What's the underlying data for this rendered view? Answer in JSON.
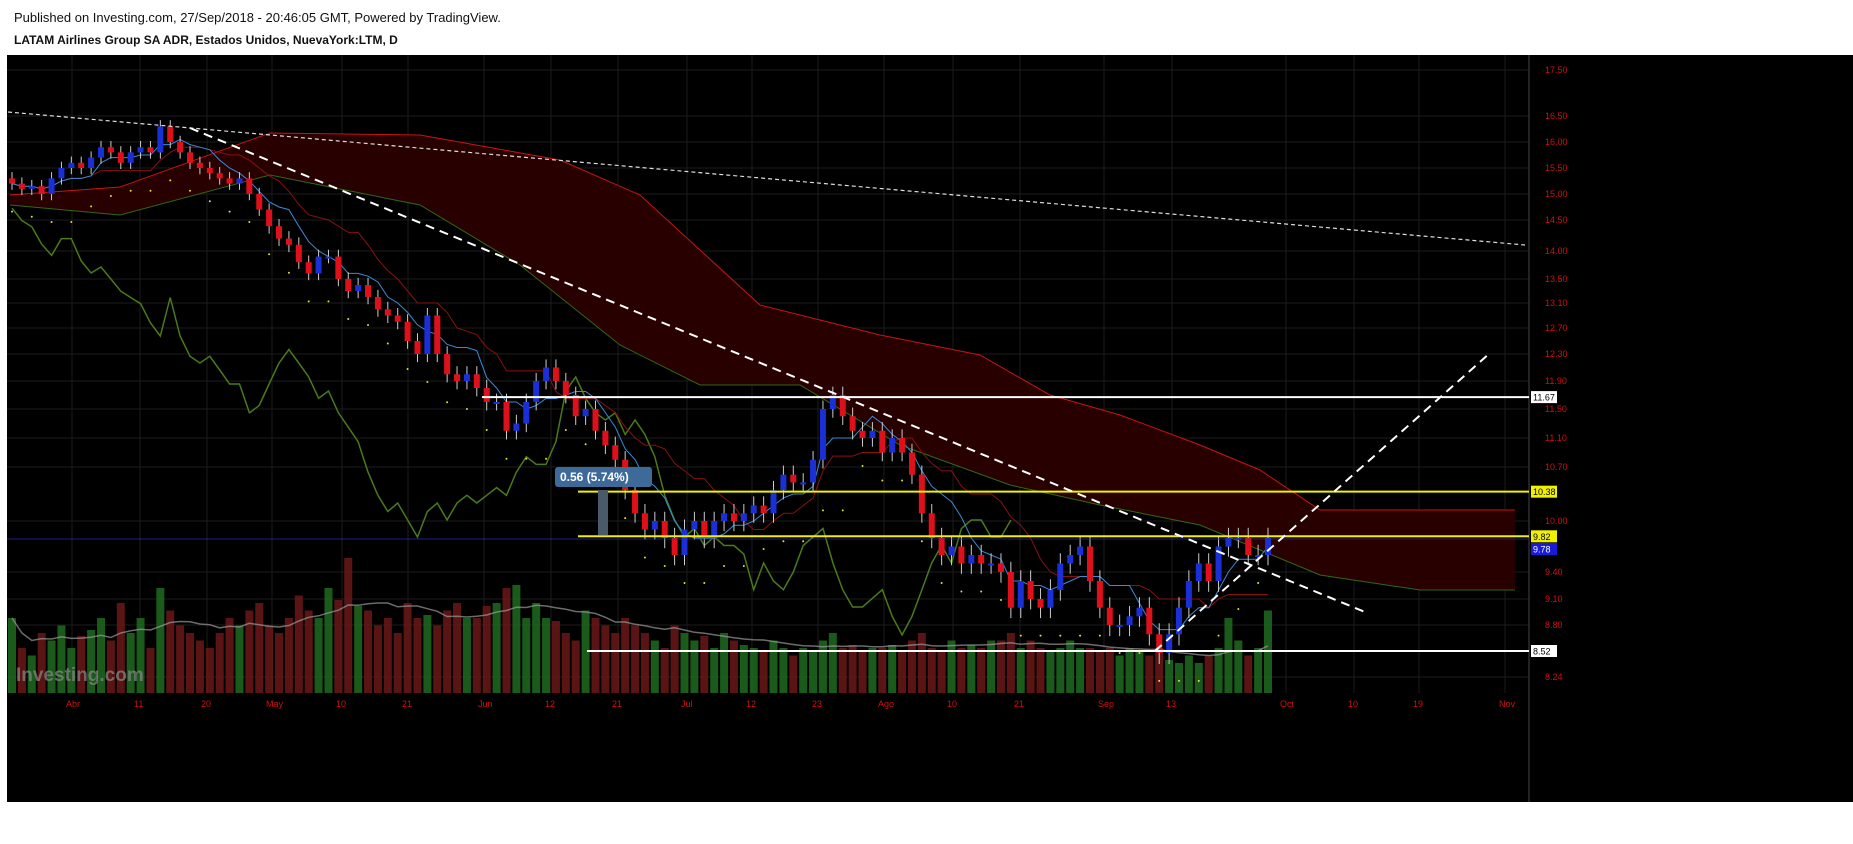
{
  "header": {
    "published": "Published on Investing.com, 27/Sep/2018 - 20:46:05 GMT, Powered by TradingView.",
    "symbol_title": "LATAM Airlines Group SA ADR, Estados Unidos, NuevaYork:LTM, D"
  },
  "watermark": "Investing.com",
  "colors": {
    "background": "#000000",
    "up_candle": "#1a2fd6",
    "down_candle": "#e0101a",
    "axis_text": "#d01010",
    "horizontal_level_white": "#ffffff",
    "horizontal_level_yellow": "#f0f000",
    "cloud_fill": "#2a0000",
    "chikou": "#4a7a1a",
    "volume_up": "#1f6a1f",
    "volume_down": "#6a1818"
  },
  "measure_label": "0.56 (5.74%)",
  "chart_data": {
    "type": "candlestick",
    "title": "LATAM Airlines Group SA ADR, Estados Unidos, NuevaYork:LTM, D",
    "ylim": [
      8.2,
      17.7
    ],
    "y_ticks": [
      "17.50",
      "16.50",
      "16.00",
      "15.50",
      "15.00",
      "14.50",
      "14.00",
      "13.50",
      "13.10",
      "12.70",
      "12.30",
      "11.90",
      "11.50",
      "11.10",
      "10.70",
      "10.00",
      "9.40",
      "9.10",
      "8.80",
      "8.24"
    ],
    "x_ticks": [
      "Abr",
      "11",
      "20",
      "May",
      "10",
      "21",
      "Jun",
      "12",
      "21",
      "Jul",
      "12",
      "23",
      "Ago",
      "10",
      "21",
      "Sep",
      "13",
      "Oct",
      "10",
      "19",
      "Nov"
    ],
    "price_labels": [
      {
        "value": 11.67,
        "label": "11.67",
        "style": "white"
      },
      {
        "value": 10.38,
        "label": "10.38",
        "style": "yellow"
      },
      {
        "value": 9.82,
        "label": "9.82",
        "style": "yellow"
      },
      {
        "value": 9.78,
        "label": "9.78",
        "style": "blue"
      },
      {
        "value": 8.52,
        "label": "8.52",
        "style": "white"
      }
    ],
    "horizontal_levels": [
      {
        "value": 11.67,
        "color": "white"
      },
      {
        "value": 10.38,
        "color": "yellow"
      },
      {
        "value": 9.82,
        "color": "yellow"
      },
      {
        "value": 8.52,
        "color": "white"
      }
    ],
    "close": [
      15.2,
      15.1,
      15.15,
      15.0,
      15.3,
      15.5,
      15.6,
      15.5,
      15.7,
      15.9,
      15.8,
      15.6,
      15.8,
      15.9,
      15.8,
      16.3,
      16.0,
      15.8,
      15.6,
      15.5,
      15.4,
      15.3,
      15.2,
      15.3,
      15.0,
      14.7,
      14.4,
      14.2,
      14.1,
      13.8,
      13.6,
      13.9,
      13.9,
      13.5,
      13.3,
      13.4,
      13.2,
      13.0,
      12.9,
      12.8,
      12.5,
      12.3,
      12.9,
      12.3,
      12.0,
      11.9,
      12.0,
      11.8,
      11.6,
      11.6,
      11.2,
      11.3,
      11.6,
      11.9,
      12.1,
      11.9,
      11.7,
      11.4,
      11.5,
      11.2,
      11.0,
      10.8,
      10.4,
      10.1,
      9.9,
      10.0,
      9.8,
      9.6,
      9.9,
      10.0,
      9.8,
      10.0,
      10.1,
      10.0,
      10.1,
      10.2,
      10.1,
      10.4,
      10.6,
      10.5,
      10.5,
      10.8,
      11.5,
      11.7,
      11.4,
      11.2,
      11.1,
      11.2,
      10.9,
      11.1,
      10.9,
      10.6,
      10.1,
      9.8,
      9.6,
      9.7,
      9.5,
      9.6,
      9.5,
      9.5,
      9.4,
      9.0,
      9.3,
      9.1,
      9.0,
      9.2,
      9.5,
      9.6,
      9.7,
      9.3,
      9.0,
      8.8,
      8.8,
      8.9,
      9.0,
      8.7,
      8.5,
      8.7,
      9.0,
      9.3,
      9.5,
      9.3,
      9.7,
      9.8,
      9.8,
      9.6,
      9.6,
      9.8
    ],
    "volume_relative": [
      0.5,
      0.3,
      0.25,
      0.4,
      0.35,
      0.45,
      0.3,
      0.38,
      0.42,
      0.5,
      0.35,
      0.6,
      0.4,
      0.5,
      0.3,
      0.7,
      0.55,
      0.45,
      0.4,
      0.35,
      0.3,
      0.4,
      0.5,
      0.45,
      0.55,
      0.6,
      0.45,
      0.4,
      0.5,
      0.65,
      0.55,
      0.5,
      0.7,
      0.62,
      0.9,
      0.58,
      0.55,
      0.45,
      0.5,
      0.4,
      0.6,
      0.5,
      0.52,
      0.45,
      0.55,
      0.6,
      0.5,
      0.5,
      0.58,
      0.6,
      0.7,
      0.72,
      0.5,
      0.6,
      0.5,
      0.48,
      0.4,
      0.35,
      0.55,
      0.5,
      0.45,
      0.4,
      0.5,
      0.45,
      0.4,
      0.35,
      0.3,
      0.45,
      0.4,
      0.35,
      0.38,
      0.3,
      0.4,
      0.35,
      0.32,
      0.3,
      0.28,
      0.35,
      0.3,
      0.25,
      0.3,
      0.28,
      0.35,
      0.4,
      0.3,
      0.32,
      0.28,
      0.3,
      0.3,
      0.32,
      0.28,
      0.35,
      0.4,
      0.3,
      0.28,
      0.35,
      0.3,
      0.32,
      0.3,
      0.35,
      0.35,
      0.4,
      0.3,
      0.35,
      0.3,
      0.28,
      0.3,
      0.35,
      0.3,
      0.3,
      0.28,
      0.3,
      0.25,
      0.3,
      0.28,
      0.25,
      0.3,
      0.22,
      0.2,
      0.25,
      0.2,
      0.25,
      0.3,
      0.5,
      0.35,
      0.25,
      0.3,
      0.55
    ]
  }
}
